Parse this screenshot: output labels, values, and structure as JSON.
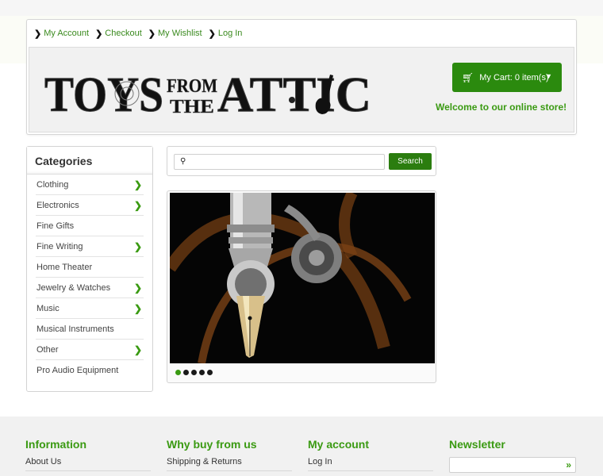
{
  "toplinks": [
    {
      "label": "My Account"
    },
    {
      "label": "Checkout"
    },
    {
      "label": "My Wishlist"
    },
    {
      "label": "Log In"
    }
  ],
  "logo": {
    "line1": "TOYS",
    "from": "FROM",
    "the": "THE",
    "attic": "ATTIC"
  },
  "cart": {
    "label": "My Cart: 0 item(s)",
    "icon": "shopping-cart-icon"
  },
  "welcome": "Welcome to our online store!",
  "categories": {
    "title": "Categories",
    "items": [
      {
        "label": "Clothing",
        "has_children": true
      },
      {
        "label": "Electronics",
        "has_children": true
      },
      {
        "label": "Fine Gifts",
        "has_children": false
      },
      {
        "label": "Fine Writing",
        "has_children": true
      },
      {
        "label": "Home Theater",
        "has_children": false
      },
      {
        "label": "Jewelry & Watches",
        "has_children": true
      },
      {
        "label": "Music",
        "has_children": true
      },
      {
        "label": "Musical Instruments",
        "has_children": false
      },
      {
        "label": "Other",
        "has_children": true
      },
      {
        "label": "Pro Audio Equipment",
        "has_children": false
      }
    ]
  },
  "search": {
    "placeholder": "",
    "value": "",
    "button": "Search"
  },
  "slider": {
    "slide_count": 5,
    "active_index": 0
  },
  "footer": {
    "columns": [
      {
        "title": "Information",
        "links": [
          "About Us"
        ]
      },
      {
        "title": "Why buy from us",
        "links": [
          "Shipping & Returns"
        ]
      },
      {
        "title": "My account",
        "links": [
          "Log In"
        ]
      }
    ],
    "newsletter": {
      "title": "Newsletter",
      "placeholder": ""
    }
  },
  "colors": {
    "accent": "#3a9a12",
    "button": "#2b8a0e"
  }
}
